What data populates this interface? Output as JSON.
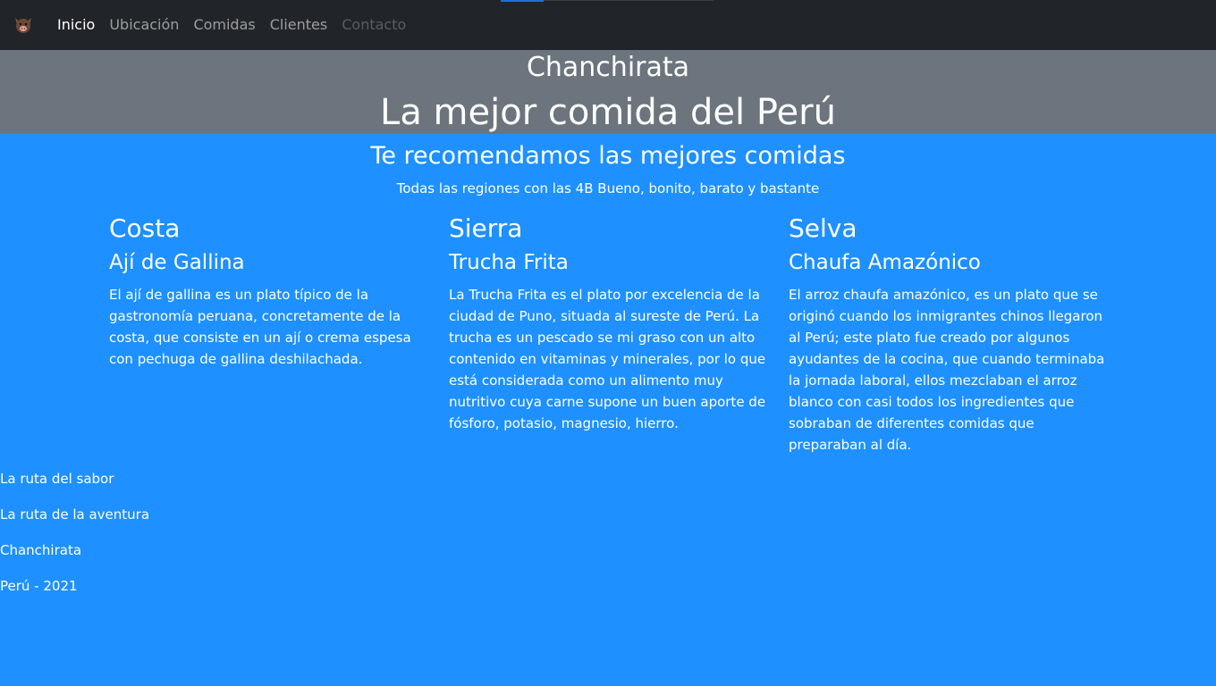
{
  "nav": {
    "links": [
      "Inicio",
      "Ubicación",
      "Comidas",
      "Clientes",
      "Contacto"
    ]
  },
  "hero": {
    "subtitle": "Chanchirata",
    "title": "La mejor comida del Perú"
  },
  "section": {
    "title": "Te recomendamos las mejores comidas",
    "subtitle": "Todas las regiones con las 4B Bueno, bonito, barato y bastante"
  },
  "regions": [
    {
      "region": "Costa",
      "dish": "Ají de Gallina",
      "description": "El ají de gallina es un plato típico de la gastronomía peruana, concretamente de la costa,  que consiste en un ají o crema espesa con pechuga de gallina deshilachada."
    },
    {
      "region": "Sierra",
      "dish": "Trucha Frita",
      "description": "La Trucha Frita es el plato por excelencia de la ciudad de Puno, situada al sureste de Perú. La trucha es un pescado se mi graso con un alto contenido en vitaminas y minerales, por lo que está considerada como un alimento muy nutritivo cuya carne supone un buen aporte de fósforo, potasio, magnesio, hierro."
    },
    {
      "region": "Selva",
      "dish": "Chaufa Amazónico",
      "description": "El arroz chaufa amazónico, es un plato que se originó cuando los inmigrantes chinos llegaron al Perú; este plato fue creado por algunos ayudantes de la cocina, que cuando terminaba la jornada laboral, ellos mezclaban el arroz blanco con casi todos los ingredientes que sobraban de diferentes comidas que preparaban al día."
    }
  ],
  "footer": {
    "lines": [
      "La ruta del sabor",
      "La ruta de la aventura",
      "Chanchirata",
      "Perú - 2021"
    ]
  },
  "colors": {
    "navbar": "#212529",
    "hero": "#6c757d",
    "page": "#1e90ff"
  },
  "icons": {
    "brand": "pig-head-icon"
  }
}
